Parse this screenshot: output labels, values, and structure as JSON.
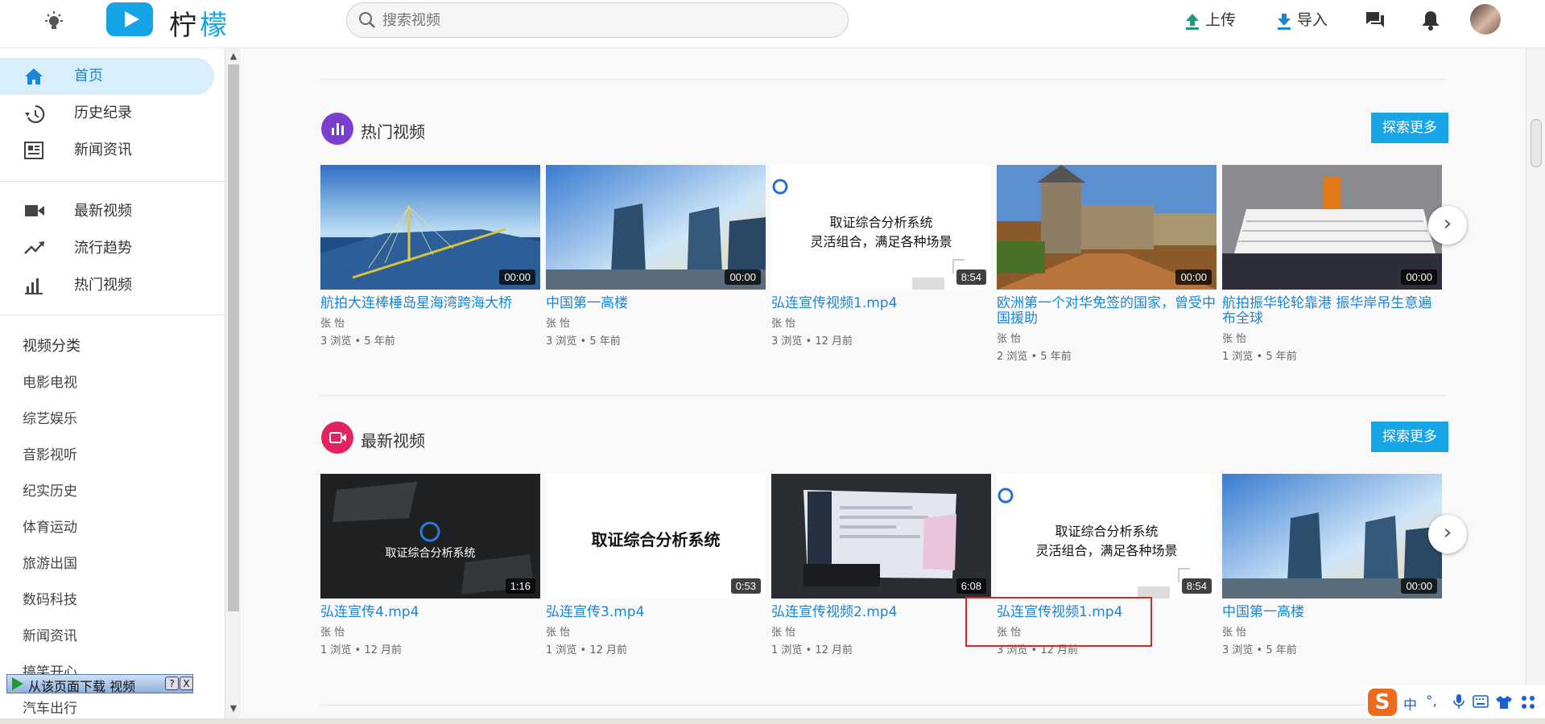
{
  "header": {
    "logo_text_a": "柠",
    "logo_text_b": "檬",
    "search_placeholder": "搜索视频",
    "upload_label": "上传",
    "import_label": "导入"
  },
  "sidebar": {
    "main_nav": [
      {
        "label": "首页",
        "icon": "home-icon"
      },
      {
        "label": "历史纪录",
        "icon": "history-icon"
      },
      {
        "label": "新闻资讯",
        "icon": "news-icon"
      }
    ],
    "video_nav": [
      {
        "label": "最新视频",
        "icon": "video-camera-icon"
      },
      {
        "label": "流行趋势",
        "icon": "trending-icon"
      },
      {
        "label": "热门视频",
        "icon": "bar-chart-icon"
      }
    ],
    "category_title": "视频分类",
    "categories": [
      "电影电视",
      "综艺娱乐",
      "音影视听",
      "纪实历史",
      "体育运动",
      "旅游出国",
      "数码科技",
      "新闻资讯",
      "搞笑开心",
      "汽车出行"
    ],
    "download_bar": "从该页面下载 视频",
    "download_help": "?",
    "download_close": "X"
  },
  "sections": [
    {
      "title": "热门视频",
      "icon": "bar-chart-icon",
      "color": "#7a3fcf",
      "explore_label": "探索更多",
      "videos": [
        {
          "title": "航拍大连棒棰岛星海湾跨海大桥",
          "author": "张 怡",
          "meta": "3 浏览 • 5 年前",
          "duration": "00:00",
          "thumb": "bridge"
        },
        {
          "title": "中国第一高楼",
          "author": "张 怡",
          "meta": "3 浏览 • 5 年前",
          "duration": "00:00",
          "thumb": "towers"
        },
        {
          "title": "弘连宣传视频1.mp4",
          "author": "张 怡",
          "meta": "3 浏览 • 12 月前",
          "duration": "8:54",
          "thumb": "slide-text"
        },
        {
          "title": "欧洲第一个对华免签的国家，曾受中国援助",
          "author": "张 怡",
          "meta": "2 浏览 • 5 年前",
          "duration": "00:00",
          "thumb": "castle"
        },
        {
          "title": "航拍振华轮轮靠港 振华岸吊生意遍布全球",
          "author": "张 怡",
          "meta": "1 浏览 • 5 年前",
          "duration": "00:00",
          "thumb": "ship"
        }
      ]
    },
    {
      "title": "最新视频",
      "icon": "video-camera-icon",
      "color": "#e2235d",
      "explore_label": "探索更多",
      "videos": [
        {
          "title": "弘连宣传4.mp4",
          "author": "张 怡",
          "meta": "1 浏览 • 12 月前",
          "duration": "1:16",
          "thumb": "dark-logo"
        },
        {
          "title": "弘连宣传3.mp4",
          "author": "张 怡",
          "meta": "1 浏览 • 12 月前",
          "duration": "0:53",
          "thumb": "white-title"
        },
        {
          "title": "弘连宣传视频2.mp4",
          "author": "张 怡",
          "meta": "1 浏览 • 12 月前",
          "duration": "6:08",
          "thumb": "screens"
        },
        {
          "title": "弘连宣传视频1.mp4",
          "author": "张 怡",
          "meta": "3 浏览 • 12 月前",
          "duration": "8:54",
          "thumb": "slide-text"
        },
        {
          "title": "中国第一高楼",
          "author": "张 怡",
          "meta": "3 浏览 • 5 年前",
          "duration": "00:00",
          "thumb": "towers"
        }
      ]
    }
  ],
  "thumb_text": {
    "slide_line1": "取证综合分析系统",
    "slide_line2": "灵活组合，满足各种场景",
    "dark_logo": "取证综合分析系统",
    "white_title": "取证综合分析系统"
  },
  "ime": {
    "lang": "中",
    "punct": "°,"
  }
}
